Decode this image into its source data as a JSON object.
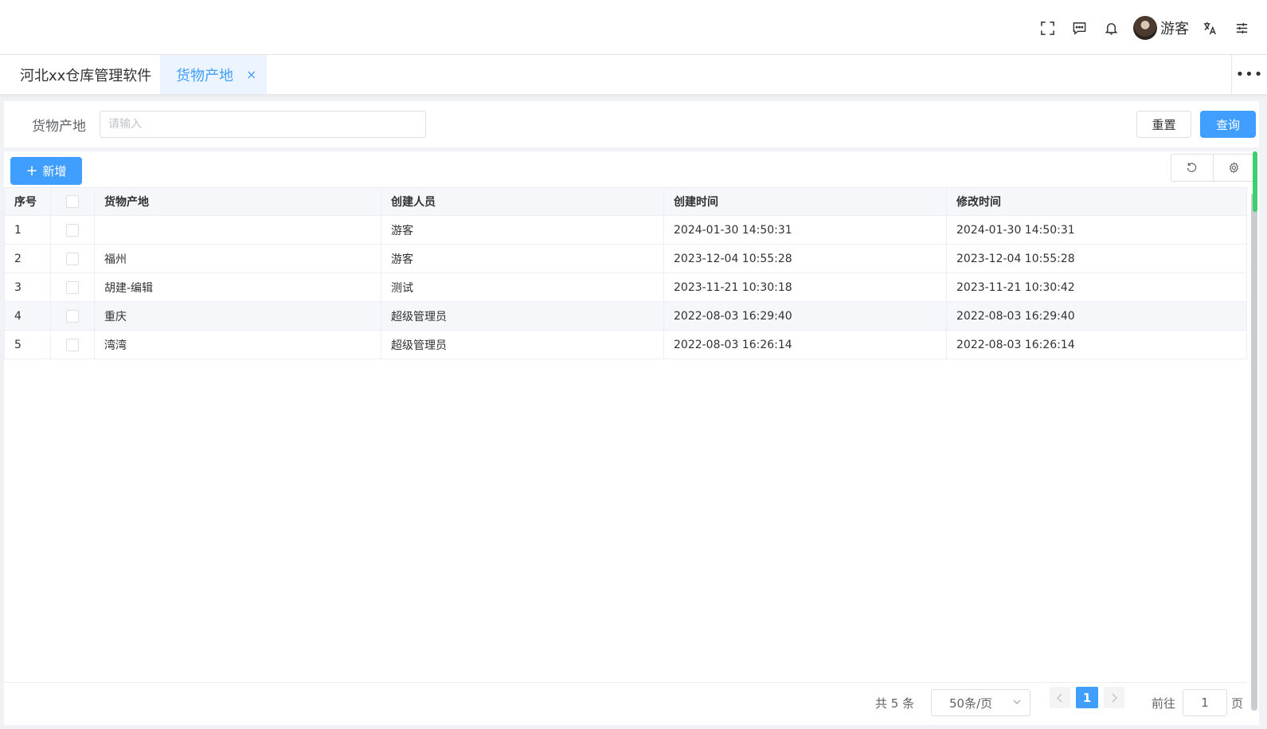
{
  "header": {
    "icons": [
      "fullscreen-icon",
      "message-icon",
      "bell-icon",
      "translate-icon",
      "settings-sliders-icon"
    ],
    "user_name": "游客"
  },
  "tabs": {
    "home_label": "河北xx仓库管理软件",
    "active_label": "货物产地",
    "close_glyph": "×",
    "more_glyph": "•••"
  },
  "search": {
    "label": "货物产地",
    "placeholder": "请输入",
    "value": "",
    "reset_label": "重置",
    "query_label": "查询"
  },
  "toolbar": {
    "add_plus": "+",
    "add_label": "新增"
  },
  "table": {
    "columns": [
      "序号",
      "",
      "货物产地",
      "创建人员",
      "创建时间",
      "修改时间"
    ],
    "rows": [
      {
        "index": "1",
        "origin": "",
        "creator": "游客",
        "created": "2024-01-30 14:50:31",
        "modified": "2024-01-30 14:50:31"
      },
      {
        "index": "2",
        "origin": "福州",
        "creator": "游客",
        "created": "2023-12-04 10:55:28",
        "modified": "2023-12-04 10:55:28"
      },
      {
        "index": "3",
        "origin": "胡建-编辑",
        "creator": "测试",
        "created": "2023-11-21 10:30:18",
        "modified": "2023-11-21 10:30:42"
      },
      {
        "index": "4",
        "origin": "重庆",
        "creator": "超级管理员",
        "created": "2022-08-03 16:29:40",
        "modified": "2022-08-03 16:29:40"
      },
      {
        "index": "5",
        "origin": "湾湾",
        "creator": "超级管理员",
        "created": "2022-08-03 16:26:14",
        "modified": "2022-08-03 16:26:14"
      }
    ]
  },
  "pagination": {
    "total_text": "共 5 条",
    "page_size": "50条/页",
    "current_page": "1",
    "goto_label": "前往",
    "goto_value": "1",
    "page_suffix": "页"
  },
  "colors": {
    "primary": "#409eff",
    "scroll_accent": "#3ccf6e"
  }
}
